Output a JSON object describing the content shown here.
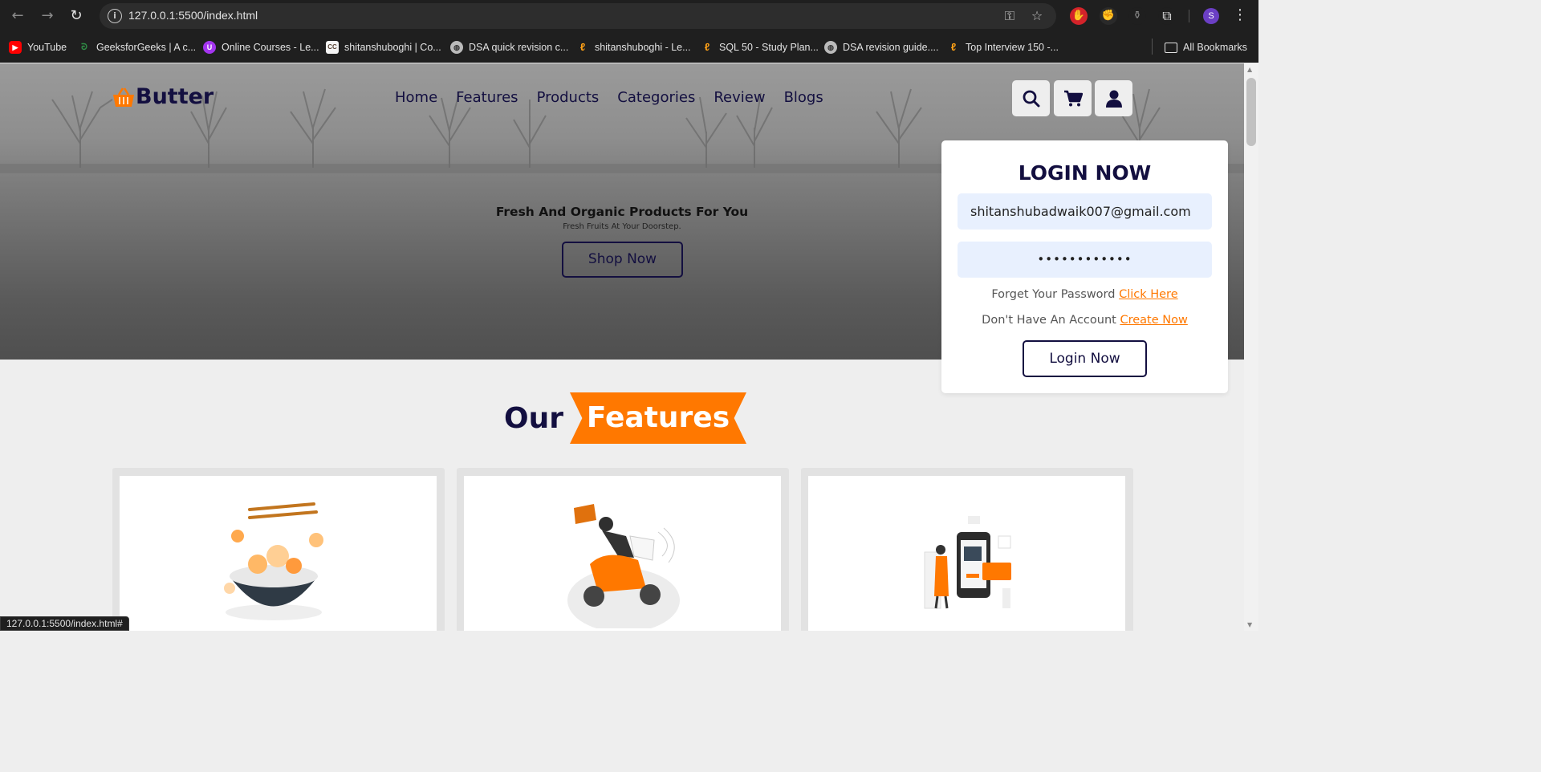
{
  "browser": {
    "url": "127.0.0.1:5500/index.html",
    "profile_initial": "S",
    "status_url": "127.0.0.1:5500/index.html#",
    "bookmarks": [
      {
        "label": "YouTube",
        "icon": "youtube-icon",
        "color": "#ff0000"
      },
      {
        "label": "GeeksforGeeks | A c...",
        "icon": "gfg-icon",
        "color": "#2f8d46"
      },
      {
        "label": "Online Courses - Le...",
        "icon": "udemy-icon",
        "color": "#a435f0"
      },
      {
        "label": "shitanshuboghi | Co...",
        "icon": "codechef-icon",
        "color": "#5b4638"
      },
      {
        "label": "DSA quick revision c...",
        "icon": "globe-icon",
        "color": "#888888"
      },
      {
        "label": "shitanshuboghi - Le...",
        "icon": "leetcode-icon",
        "color": "#ffa116"
      },
      {
        "label": "SQL 50 - Study Plan...",
        "icon": "leetcode-icon",
        "color": "#ffa116"
      },
      {
        "label": "DSA revision guide....",
        "icon": "globe-icon",
        "color": "#888888"
      },
      {
        "label": "Top Interview 150 -...",
        "icon": "leetcode-icon",
        "color": "#ffa116"
      }
    ],
    "all_bookmarks": "All Bookmarks"
  },
  "site": {
    "brand": "Butter",
    "accent": "#ff7800",
    "primary": "#130f40",
    "nav": [
      "Home",
      "Features",
      "Products",
      "Categories",
      "Review",
      "Blogs"
    ]
  },
  "hero": {
    "title": "Fresh And Organic Products For You",
    "subtitle": "Fresh Fruits At Your Doorstep.",
    "cta": "Shop Now"
  },
  "login": {
    "title": "LOGIN NOW",
    "email": "shitanshubadwaik007@gmail.com",
    "password_mask": "••••••••••••",
    "forgot_text": "Forget Your Password",
    "forgot_link": "Click Here",
    "account_text": "Don't Have An Account",
    "account_link": "Create Now",
    "submit": "Login Now"
  },
  "features": {
    "heading_plain": "Our",
    "heading_highlight": "Features",
    "cards": [
      {
        "illustration": "food-bowl-illustration"
      },
      {
        "illustration": "delivery-scooter-illustration"
      },
      {
        "illustration": "mobile-payment-illustration"
      }
    ]
  }
}
